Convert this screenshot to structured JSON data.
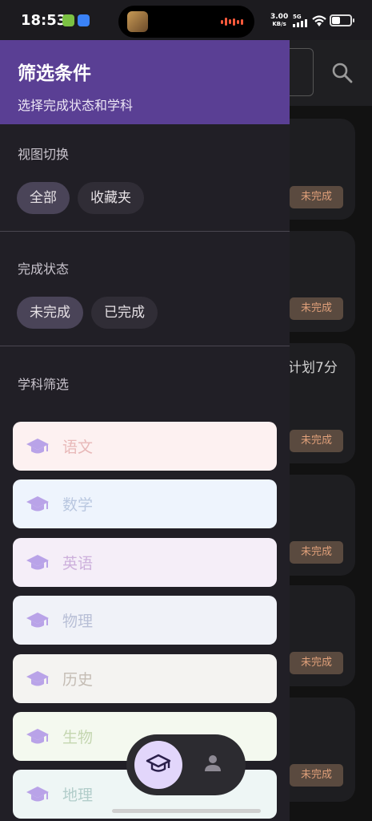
{
  "status_bar": {
    "time": "18:53",
    "net_speed_value": "3.00",
    "net_speed_unit": "KB/s",
    "network": "5G"
  },
  "drawer": {
    "title": "筛选条件",
    "subtitle": "选择完成状态和学科",
    "view_section": {
      "title": "视图切换",
      "chips": [
        {
          "label": "全部",
          "selected": true
        },
        {
          "label": "收藏夹",
          "selected": false
        }
      ]
    },
    "status_section": {
      "title": "完成状态",
      "chips": [
        {
          "label": "未完成",
          "selected": true
        },
        {
          "label": "已完成",
          "selected": false
        }
      ]
    },
    "subject_section": {
      "title": "学科筛选",
      "subjects": [
        {
          "label": "语文",
          "bg": "#fdf1f1",
          "fg": "#e8b8b8",
          "icon_color": "#b9a3e8"
        },
        {
          "label": "数学",
          "bg": "#eef4fd",
          "fg": "#b9c7e0",
          "icon_color": "#b9a3e8"
        },
        {
          "label": "英语",
          "bg": "#f5eef8",
          "fg": "#cdb0dc",
          "icon_color": "#b9a3e8"
        },
        {
          "label": "物理",
          "bg": "#f0f2f8",
          "fg": "#b8bfd6",
          "icon_color": "#b9a3e8"
        },
        {
          "label": "历史",
          "bg": "#f4f3f1",
          "fg": "#c4bcb4",
          "icon_color": "#b9a3e8"
        },
        {
          "label": "生物",
          "bg": "#f4f9ef",
          "fg": "#c4d6b0",
          "icon_color": "#b9a3e8"
        },
        {
          "label": "地理",
          "bg": "#eef6f5",
          "fg": "#b2cdca",
          "icon_color": "#b9a3e8"
        }
      ]
    }
  },
  "background": {
    "badge_label": "未完成",
    "partial_text": "计划7分"
  },
  "bottom_nav": {
    "items": [
      {
        "icon": "graduation-cap-icon",
        "active": true
      },
      {
        "icon": "person-icon",
        "active": false
      }
    ]
  },
  "colors": {
    "header_bg": "#5a3f94",
    "drawer_bg": "#211f26",
    "chip_selected_bg": "#4a4458",
    "badge_bg": "#5a4a3f",
    "badge_fg": "#e0a07a",
    "nav_active_bg": "#e2d6fb"
  }
}
